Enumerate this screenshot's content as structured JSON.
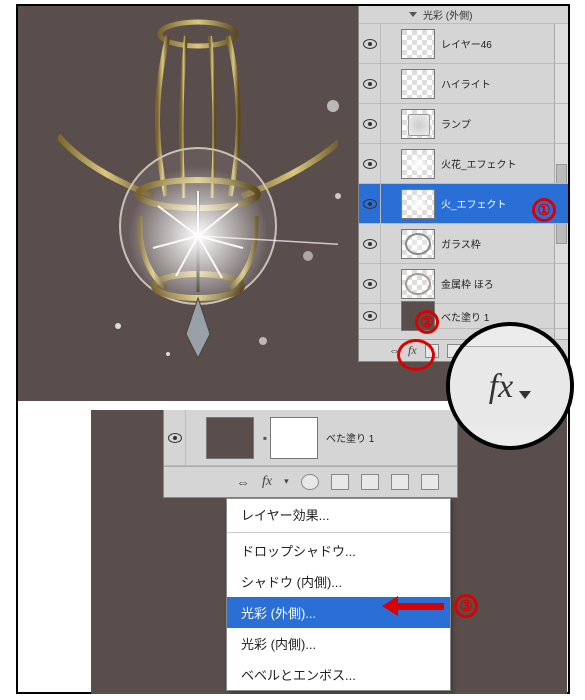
{
  "panel1": {
    "header": "光彩 (外側)",
    "layers": [
      {
        "name": "レイヤー46",
        "thumb": "checker"
      },
      {
        "name": "ハイライト",
        "thumb": "checker"
      },
      {
        "name": "ランプ",
        "thumb": "lamp"
      },
      {
        "name": "火花_エフェクト",
        "thumb": "fire"
      },
      {
        "name": "火_エフェクト",
        "thumb": "fire",
        "selected": true
      },
      {
        "name": "ガラス枠",
        "thumb": "glass"
      },
      {
        "name": "金属枠 ほろ",
        "thumb": "ring"
      },
      {
        "name": "べた塗り 1",
        "thumb": "solid",
        "short": true
      }
    ],
    "footer": {
      "fx_label": "fx"
    }
  },
  "annotations": {
    "num1": "①",
    "num2": "②",
    "num3": "③",
    "fx_zoom_label": "fx"
  },
  "panel2": {
    "base_layer_name": "べた塗り 1",
    "footer": {
      "fx_label": "fx"
    }
  },
  "menu": {
    "items": [
      {
        "label": "レイヤー効果...",
        "hl": false
      },
      {
        "label": "ドロップシャドウ...",
        "hl": false
      },
      {
        "label": "シャドウ (内側)...",
        "hl": false
      },
      {
        "label": "光彩 (外側)...",
        "hl": true
      },
      {
        "label": "光彩 (内側)...",
        "hl": false
      },
      {
        "label": "ベベルとエンボス...",
        "hl": false
      }
    ]
  }
}
